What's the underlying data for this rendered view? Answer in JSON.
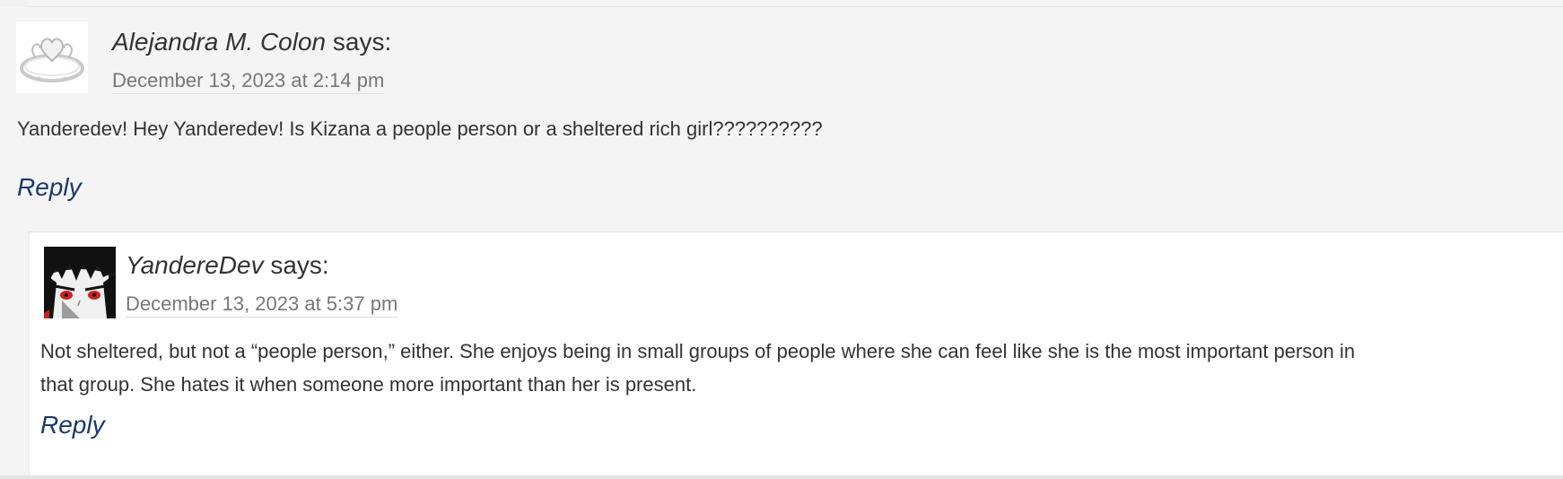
{
  "comments": [
    {
      "author": "Alejandra M. Colon",
      "says": "says:",
      "date": "December 13, 2023 at 2:14 pm",
      "text": "Yanderedev! Hey Yanderedev! Is Kizana a people person or a sheltered rich girl??????????",
      "reply_label": "Reply",
      "avatar_icon": "ring-avatar-icon"
    },
    {
      "author": "YandereDev",
      "says": "says:",
      "date": "December 13, 2023 at 5:37 pm",
      "text_lines": [
        "Not sheltered, but not a “people person,” either. She enjoys being in small groups of people where she can feel like she is the most important person in",
        "that group. She hates it when someone more important than her is present."
      ],
      "reply_label": "Reply",
      "avatar_icon": "anime-face-avatar-icon"
    }
  ],
  "colors": {
    "outer_background": "#f4f4f4",
    "child_background": "#ffffff",
    "link": "#1a3a6b",
    "date": "#777777",
    "text": "#333333"
  }
}
